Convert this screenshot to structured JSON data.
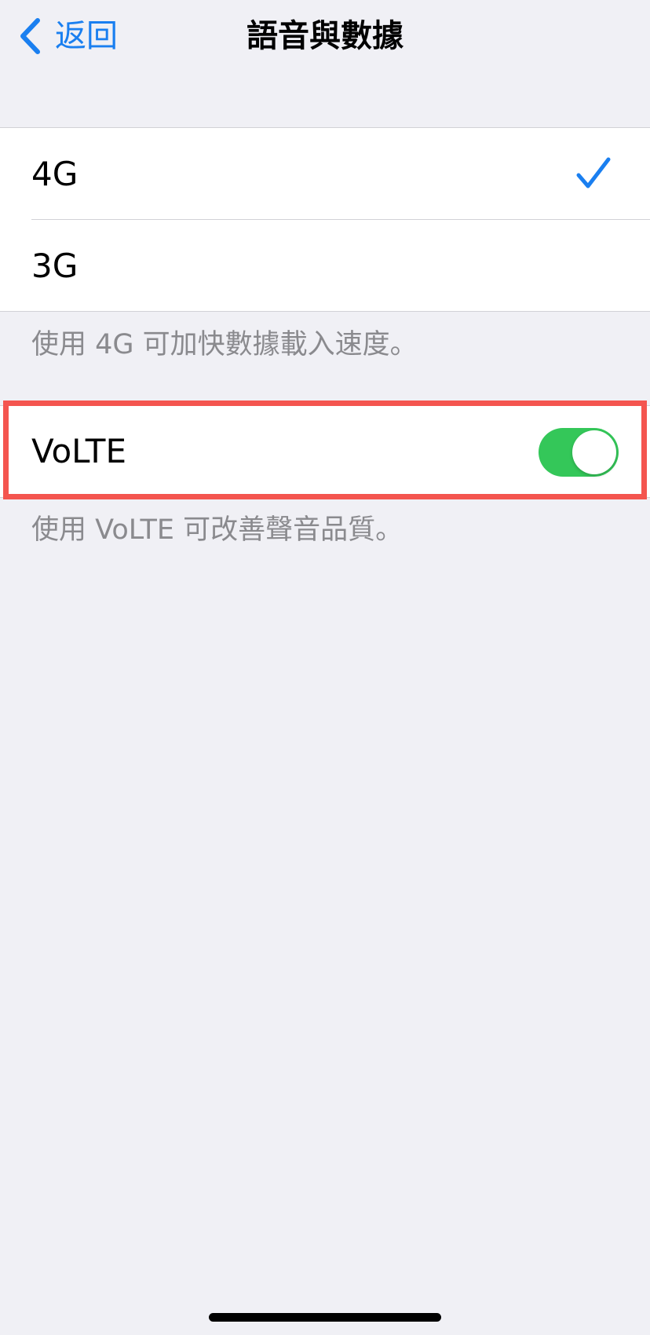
{
  "navbar": {
    "back_label": "返回",
    "title": "語音與數據"
  },
  "network": {
    "options": [
      {
        "label": "4G",
        "selected": true
      },
      {
        "label": "3G",
        "selected": false
      }
    ],
    "footnote": "使用 4G 可加快數據載入速度。"
  },
  "volte": {
    "label": "VoLTE",
    "enabled": true,
    "footnote": "使用 VoLTE 可改善聲音品質。"
  },
  "colors": {
    "accent": "#1a7ff0",
    "toggle_on": "#34c759",
    "highlight": "#f4554f",
    "background": "#f0f0f5"
  }
}
